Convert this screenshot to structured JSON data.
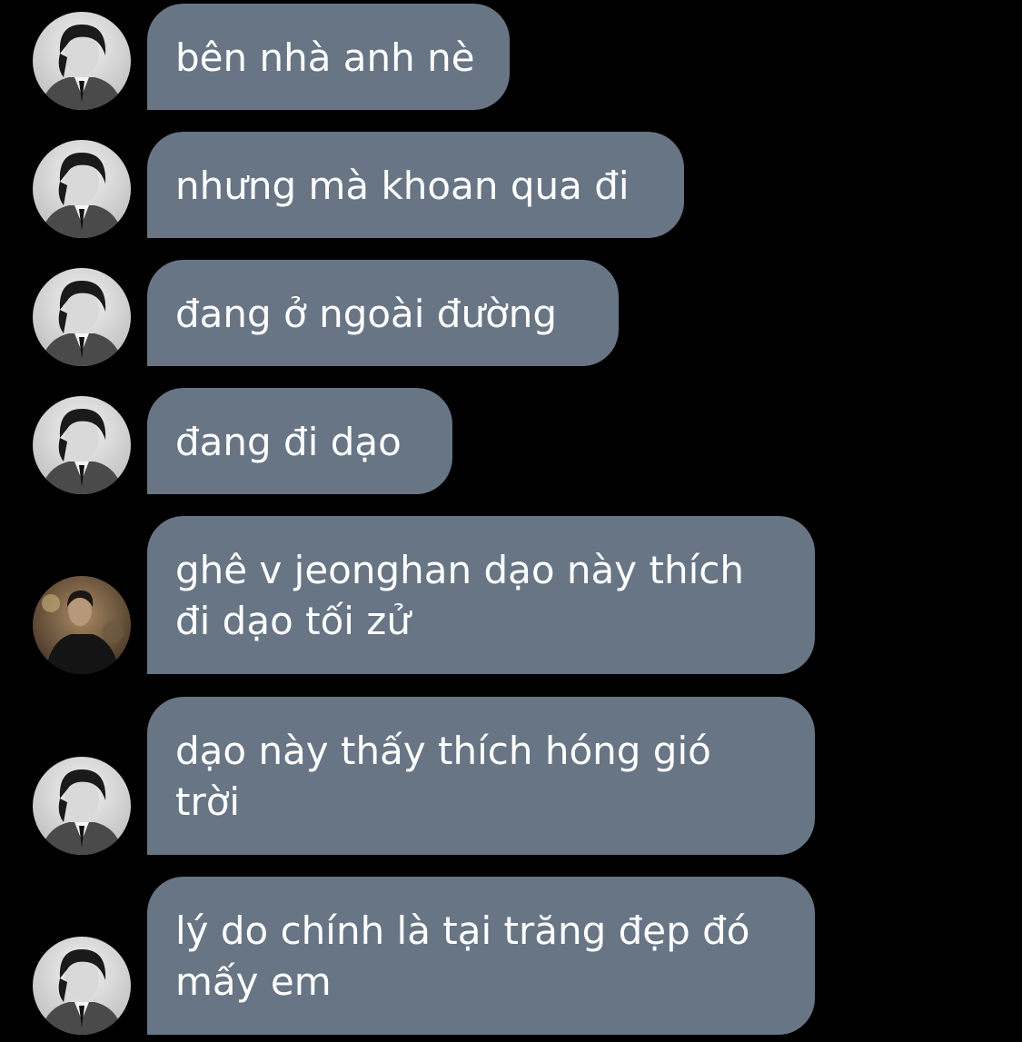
{
  "conversation": {
    "messages": [
      {
        "sender": "user-a",
        "lines": [
          "bên nhà anh nè"
        ]
      },
      {
        "sender": "user-a",
        "lines": [
          "nhưng mà khoan qua đi"
        ]
      },
      {
        "sender": "user-a",
        "lines": [
          "đang ở ngoài đường"
        ]
      },
      {
        "sender": "user-a",
        "lines": [
          "đang đi dạo"
        ]
      },
      {
        "sender": "user-b",
        "lines": [
          "ghê v jeonghan dạo này thích",
          "đi dạo tối zử"
        ]
      },
      {
        "sender": "user-a",
        "lines": [
          "dạo này thấy thích hóng gió",
          "trời"
        ]
      },
      {
        "sender": "user-a",
        "lines": [
          "lý do chính là tại trăng đẹp đó",
          "mấy em"
        ]
      }
    ]
  },
  "theme": {
    "background": "#000000",
    "bubble_color": "#687585",
    "text_color": "#ffffff"
  },
  "icons": {
    "user_a_avatar": "black-and-white-portrait-avatar",
    "user_b_avatar": "color-portrait-avatar"
  }
}
